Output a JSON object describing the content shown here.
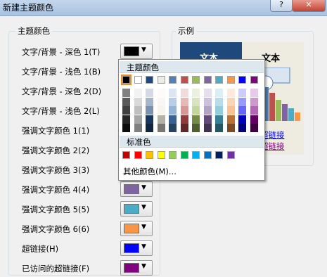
{
  "window": {
    "title": "新建主题颜色",
    "help_label": "?",
    "close_label": "✕"
  },
  "theme_group": {
    "label": "主题颜色"
  },
  "preview_group": {
    "label": "示例"
  },
  "rows": [
    {
      "label": "文字/背景 - 深色 1(T)",
      "color": "#000000"
    },
    {
      "label": "文字/背景 - 浅色 1(B)",
      "color": "#ffffff"
    },
    {
      "label": "文字/背景 - 深色 2(D)",
      "color": "#1f497d"
    },
    {
      "label": "文字/背景 - 浅色 2(L)",
      "color": "#eeece1"
    },
    {
      "label": "强调文字颜色 1(1)",
      "color": "#4f81bd"
    },
    {
      "label": "强调文字颜色 2(2)",
      "color": "#c0504d"
    },
    {
      "label": "强调文字颜色 3(3)",
      "color": "#9bbb59"
    },
    {
      "label": "强调文字颜色 4(4)",
      "color": "#8064a2"
    },
    {
      "label": "强调文字颜色 5(5)",
      "color": "#4bacc6"
    },
    {
      "label": "强调文字颜色 6(6)",
      "color": "#f79646"
    },
    {
      "label": "超链接(H)",
      "color": "#0000ff"
    },
    {
      "label": "已访问的超链接(F)",
      "color": "#800080"
    }
  ],
  "preview": {
    "text_dark": "文本",
    "text_light": "文本",
    "link1": "超链接",
    "link2": "超链接"
  },
  "popup": {
    "theme_header": "主题颜色",
    "standard_header": "标准色",
    "more_colors": "其他颜色(M)...",
    "theme_colors": [
      "#000000",
      "#ffffff",
      "#1f497d",
      "#eeece1",
      "#4f81bd",
      "#c0504d",
      "#9bbb59",
      "#8064a2",
      "#4bacc6",
      "#f79646",
      "#0000ff",
      "#800080"
    ],
    "standard_colors": [
      "#c00000",
      "#ff0000",
      "#ffc000",
      "#ffff00",
      "#92d050",
      "#00b050",
      "#00b0f0",
      "#0070c0",
      "#002060",
      "#7030a0"
    ],
    "selected_index": 0
  }
}
